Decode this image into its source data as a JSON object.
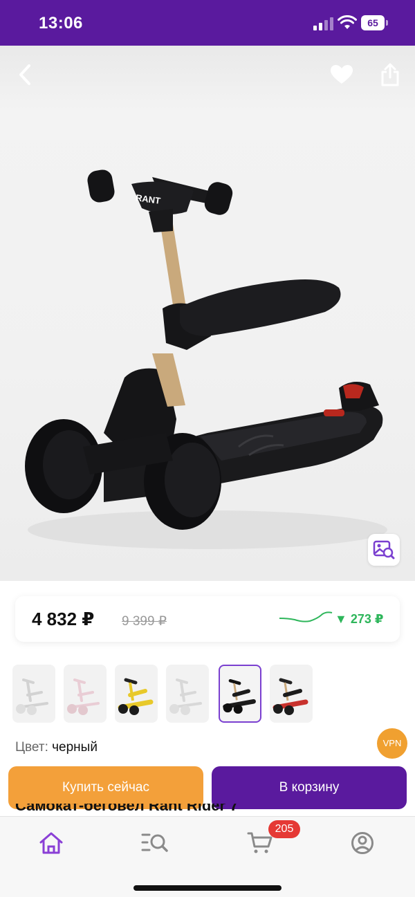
{
  "status_bar": {
    "time": "13:06",
    "battery": "65",
    "icons": [
      "signal-icon",
      "wifi-icon",
      "battery-icon"
    ]
  },
  "product": {
    "image_brand_text": "RANT",
    "title_partial": "Самокат-беговел Rant Rider 7"
  },
  "price": {
    "current": "4 832 ₽",
    "old": "9 399 ₽",
    "diff": "▼ 273 ₽"
  },
  "variants": [
    {
      "color": "white",
      "selected": false
    },
    {
      "color": "pink",
      "selected": false
    },
    {
      "color": "yellow",
      "selected": false
    },
    {
      "color": "white",
      "selected": false
    },
    {
      "color": "black",
      "selected": true
    },
    {
      "color": "red",
      "selected": false
    }
  ],
  "color_row": {
    "label": "Цвет:",
    "value": "черный"
  },
  "vpn_badge": "VPN",
  "actions": {
    "buy_now": "Купить сейчас",
    "add_to_cart": "В корзину"
  },
  "bottom_nav": {
    "items": [
      "home-icon",
      "catalog-search-icon",
      "cart-icon",
      "profile-icon"
    ],
    "cart_count": "205"
  },
  "colors": {
    "brand_purple": "#5a1a9e",
    "buy_orange": "#f3a03a",
    "price_drop_green": "#2eb65b",
    "badge_red": "#e53935"
  }
}
